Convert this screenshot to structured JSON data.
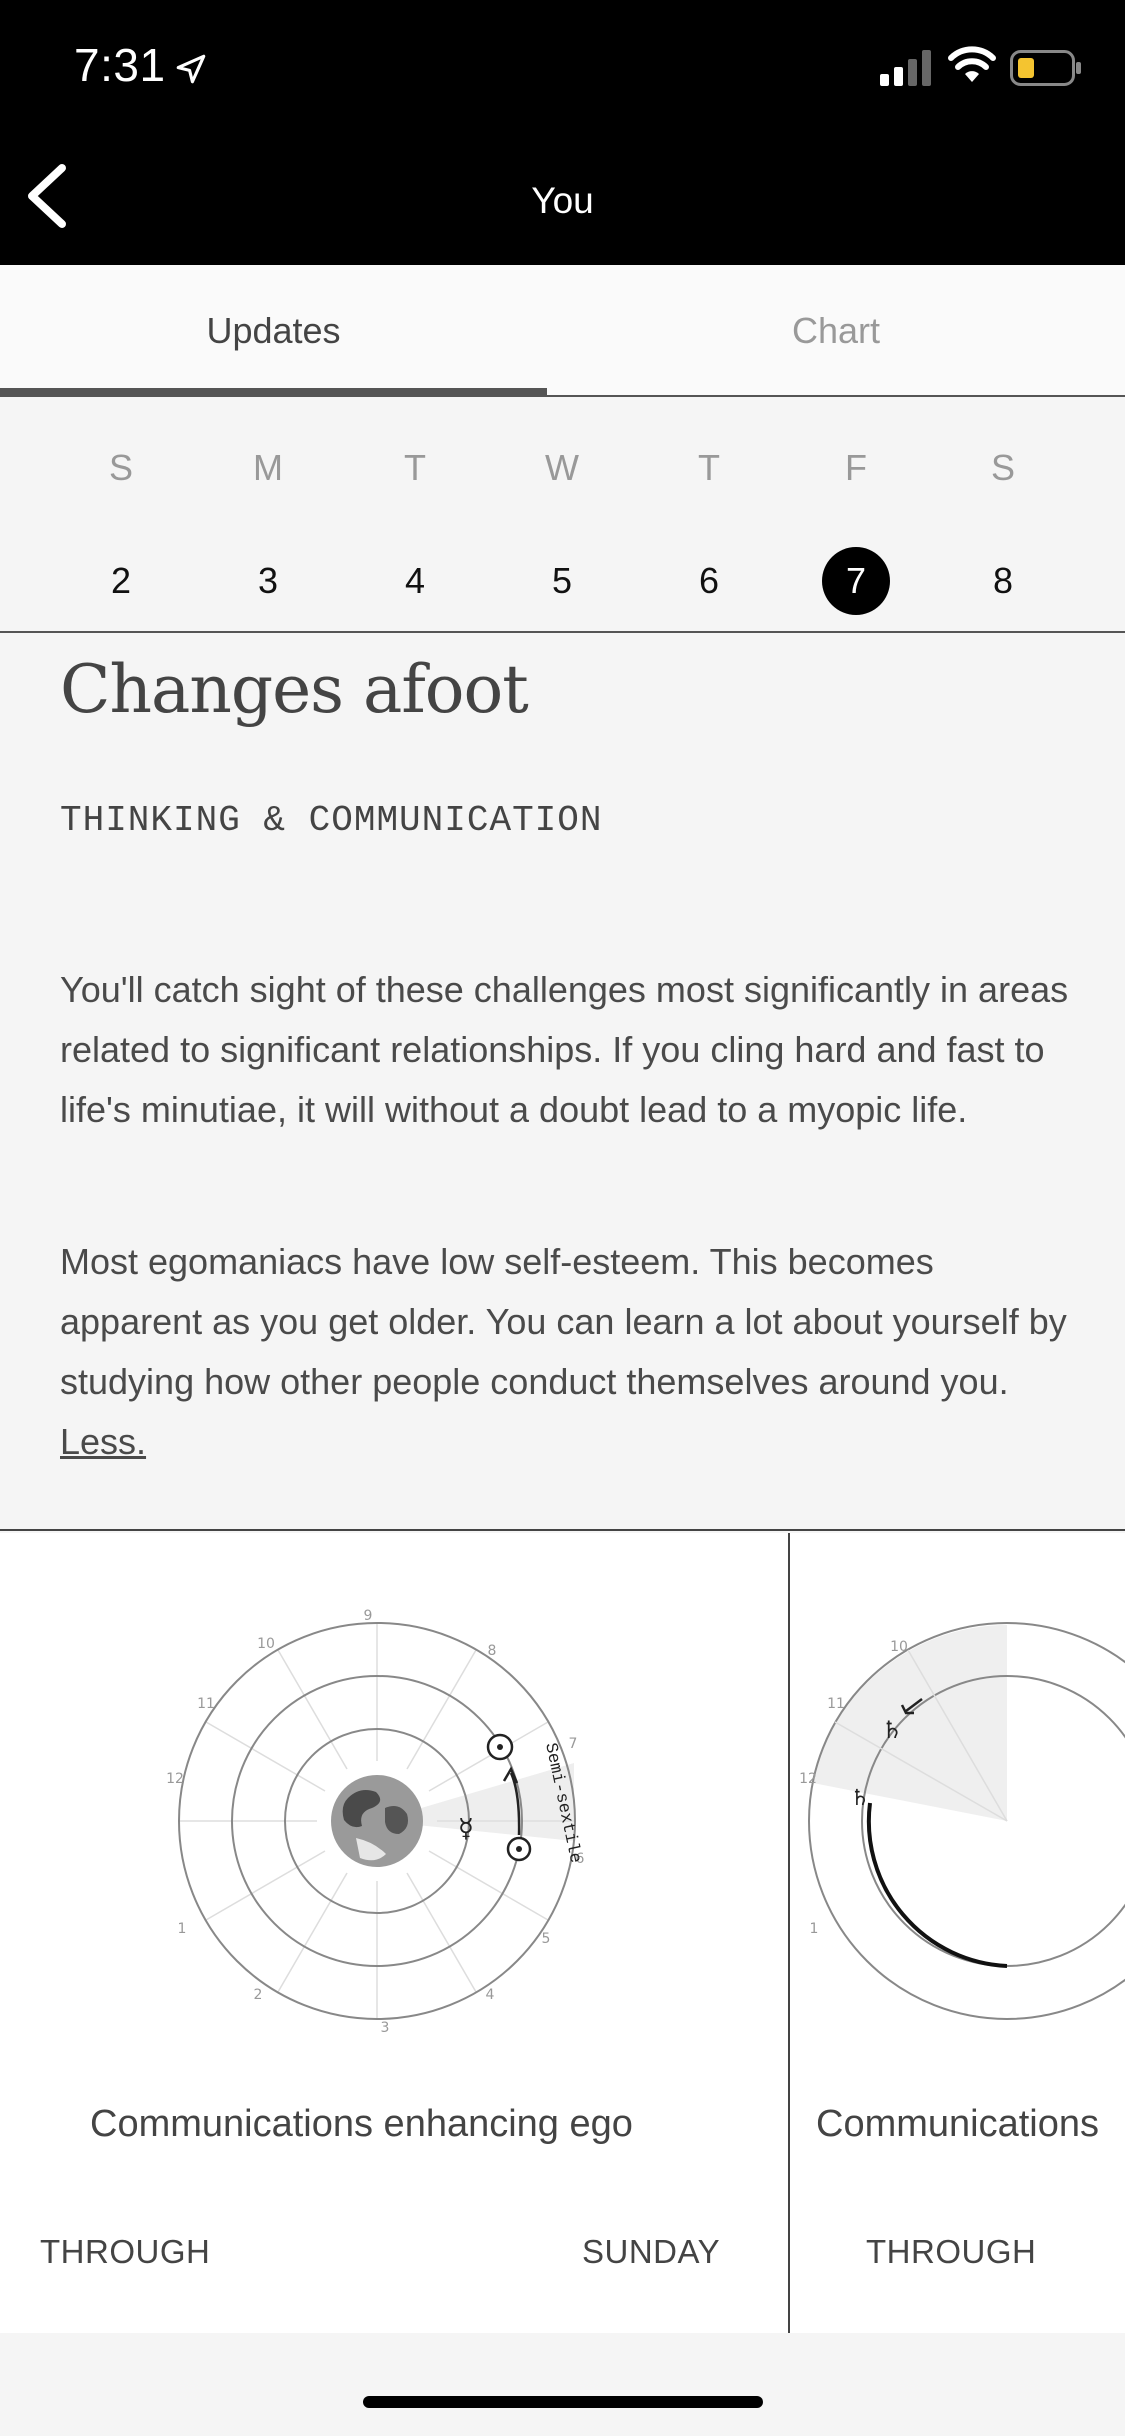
{
  "status_bar": {
    "time": "7:31"
  },
  "nav": {
    "title": "You"
  },
  "tabs": [
    {
      "label": "Updates",
      "active": true
    },
    {
      "label": "Chart",
      "active": false
    }
  ],
  "calendar": {
    "weekdays": [
      "S",
      "M",
      "T",
      "W",
      "T",
      "F",
      "S"
    ],
    "dates": [
      "2",
      "3",
      "4",
      "5",
      "6",
      "7",
      "8"
    ],
    "selected_date": "7"
  },
  "update": {
    "headline": "Changes afoot",
    "category": "THINKING & COMMUNICATION",
    "paragraph1": "You'll catch sight of these challenges most significantly in areas related to significant relationships. If you cling hard and fast to life's minutiae, it will without a doubt lead to a myopic life.",
    "paragraph2": "Most egomaniacs have low self-esteem. This becomes apparent as you get older. You can learn a lot about yourself by studying how other people conduct themselves around you.",
    "less_link": "Less."
  },
  "transit_cards": [
    {
      "title": "Communications enhancing ego",
      "through_label": "THROUGH",
      "until": "SUNDAY",
      "aspect_label": "Semi-sextile",
      "house_numbers": [
        "1",
        "2",
        "3",
        "4",
        "5",
        "6",
        "7",
        "8",
        "9",
        "10",
        "11",
        "12"
      ]
    },
    {
      "title": "Communications",
      "through_label": "THROUGH",
      "house_numbers": [
        "1",
        "10",
        "11",
        "12"
      ]
    }
  ],
  "colors": {
    "background": "#f5f5f5",
    "bar": "#000000",
    "battery_fill": "#f4c430"
  },
  "icons": [
    "location-arrow-icon",
    "signal-icon",
    "wifi-icon",
    "battery-icon",
    "back-chevron-icon"
  ]
}
